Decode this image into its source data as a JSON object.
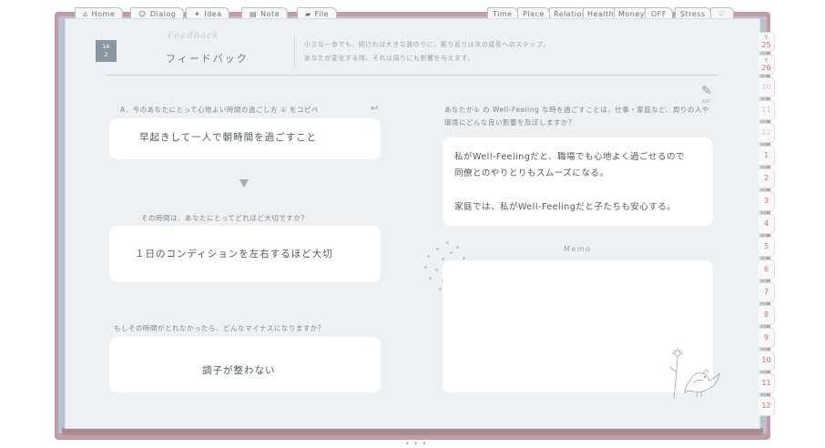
{
  "top_tabs_left": [
    {
      "icon": "⌂",
      "label": "Home"
    },
    {
      "icon": "☺",
      "label": "Dialog"
    },
    {
      "icon": "✦",
      "label": "Idea"
    },
    {
      "icon": "▤",
      "label": "Note"
    },
    {
      "icon": "▰",
      "label": "File"
    }
  ],
  "top_tabs_right": [
    "Time",
    "Place",
    "Relation",
    "Health",
    "Money",
    "OFF",
    "Stress",
    "♡"
  ],
  "month_tabs": [
    {
      "year": "Y",
      "label": "25"
    },
    {
      "year": "Y",
      "label": "26"
    },
    {
      "label": "10"
    },
    {
      "label": "11"
    },
    {
      "label": "12"
    },
    {
      "label": "1"
    },
    {
      "label": "2"
    },
    {
      "label": "3"
    },
    {
      "label": "4"
    },
    {
      "label": "5"
    },
    {
      "label": "6"
    },
    {
      "label": "7"
    },
    {
      "label": "8"
    },
    {
      "label": "9"
    },
    {
      "label": "10"
    },
    {
      "label": "11"
    },
    {
      "label": "12"
    }
  ],
  "header": {
    "badge_line1": "1A",
    "badge_line2": "2",
    "script_title": "Feedback",
    "title": "フィードバック",
    "intro_line1": "小さな一歩でも、続ければ大きな波のりに。振り返りは次の成長へのステップ。",
    "intro_line2": "あなたが変化する時、それは周りにも影響を与えます。"
  },
  "left": {
    "q1": "A．今のあなたにとって心地よい時間の過ごし方 ① をコピペ",
    "a1": "早起きして一人で朝時間を過ごすこと",
    "q2": "その時間は、あなたにとってどれほど大切ですか？",
    "a2": "１日のコンディションを左右するほど大切",
    "q3": "もしその時間がとれなかったら、どんなマイナスになりますか？",
    "a3": "調子が整わない"
  },
  "right": {
    "q1": "あなたが① の Well-Feeling な時を過ごすことは、仕事・家庭など、周りの人や環境にどんな良い影響を及ぼしますか？",
    "a1_line1": "私がWell-Feelingだと、職場でも心地よく過ごせるので",
    "a1_line2": "同僚とのやりとりもスムーズになる。",
    "a1_line3": "家庭では、私がWell-Feelingだと子たちも安心する。",
    "memo_label": "Memo",
    "edit_label": "EDIT"
  },
  "colors": {
    "binder": "#c49aa4",
    "page": "#edf1f4",
    "accent_pink": "#d46a82"
  }
}
